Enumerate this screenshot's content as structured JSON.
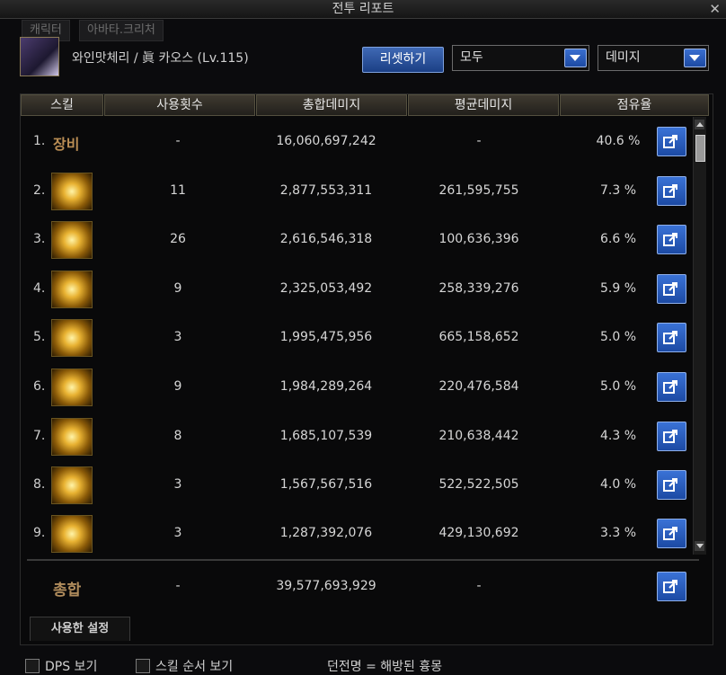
{
  "window": {
    "title": "전투 리포트"
  },
  "tabs": [
    {
      "label": "캐릭터"
    },
    {
      "label": "아바타.크리처"
    }
  ],
  "character": {
    "name": "와인맛체리 / 眞 카오스 (Lv.115)"
  },
  "controls": {
    "reset_label": "리셋하기",
    "filter_value": "모두",
    "metric_value": "데미지"
  },
  "table": {
    "headers": [
      "스킬",
      "사용횟수",
      "총합데미지",
      "평균데미지",
      "점유율"
    ],
    "rows": [
      {
        "rank": "1.",
        "name": "장비",
        "uses": "-",
        "total": "16,060,697,242",
        "avg": "-",
        "share": "40.6 %"
      },
      {
        "rank": "2.",
        "name": "",
        "uses": "11",
        "total": "2,877,553,311",
        "avg": "261,595,755",
        "share": "7.3 %"
      },
      {
        "rank": "3.",
        "name": "",
        "uses": "26",
        "total": "2,616,546,318",
        "avg": "100,636,396",
        "share": "6.6 %"
      },
      {
        "rank": "4.",
        "name": "",
        "uses": "9",
        "total": "2,325,053,492",
        "avg": "258,339,276",
        "share": "5.9 %"
      },
      {
        "rank": "5.",
        "name": "",
        "uses": "3",
        "total": "1,995,475,956",
        "avg": "665,158,652",
        "share": "5.0 %"
      },
      {
        "rank": "6.",
        "name": "",
        "uses": "9",
        "total": "1,984,289,264",
        "avg": "220,476,584",
        "share": "5.0 %"
      },
      {
        "rank": "7.",
        "name": "",
        "uses": "8",
        "total": "1,685,107,539",
        "avg": "210,638,442",
        "share": "4.3 %"
      },
      {
        "rank": "8.",
        "name": "",
        "uses": "3",
        "total": "1,567,567,516",
        "avg": "522,522,505",
        "share": "4.0 %"
      },
      {
        "rank": "9.",
        "name": "",
        "uses": "3",
        "total": "1,287,392,076",
        "avg": "429,130,692",
        "share": "3.3 %"
      }
    ],
    "total": {
      "label": "총합",
      "uses": "-",
      "total": "39,577,693,929",
      "avg": "-"
    }
  },
  "bottom_tab": {
    "label": "사용한 설정"
  },
  "footer": {
    "dps_label": "DPS 보기",
    "skill_order_label": "스킬 순서 보기",
    "note": "던전명 = 해방된 흉몽"
  },
  "colors": {
    "accent_blue": "#2a5cc0",
    "gold": "#b98d54"
  }
}
